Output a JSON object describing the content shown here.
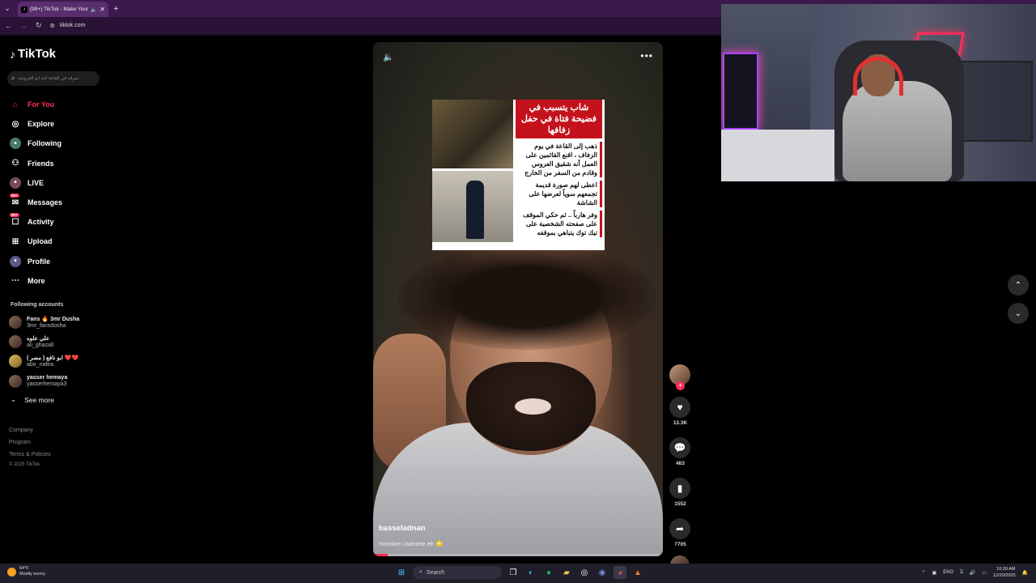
{
  "browser": {
    "tab_title": "(99+) TikTok - Make Your D...",
    "tab_close": "✕",
    "new_tab": "+",
    "url": "tiktok.com"
  },
  "sidebar": {
    "brand": "TikTok",
    "search_placeholder": "سرقه في القاعة لانه ابو العروسة",
    "nav": [
      {
        "label": "For You",
        "icon": "home-icon",
        "active": true
      },
      {
        "label": "Explore",
        "icon": "compass-icon"
      },
      {
        "label": "Following",
        "icon": "following-icon"
      },
      {
        "label": "Friends",
        "icon": "friends-icon"
      },
      {
        "label": "LIVE",
        "icon": "live-icon"
      },
      {
        "label": "Messages",
        "icon": "messages-icon",
        "badge": "99+"
      },
      {
        "label": "Activity",
        "icon": "activity-icon",
        "badge": "99+"
      },
      {
        "label": "Upload",
        "icon": "upload-icon"
      },
      {
        "label": "Profile",
        "icon": "profile-icon"
      },
      {
        "label": "More",
        "icon": "more-icon"
      }
    ],
    "following_header": "Following accounts",
    "accounts": [
      {
        "name": "Fans 🔥 3mr Dusha",
        "handle": "3mr_fansdosha"
      },
      {
        "name": "علي علوه",
        "handle": "ali_ghazall"
      },
      {
        "name": "ابو نافع ( مصر ) ❤️❤️",
        "handle": "abo_nafea"
      },
      {
        "name": "yasser hemaya",
        "handle": "yasserhemaya3"
      }
    ],
    "see_more": "See more",
    "footer": [
      "Company",
      "Program",
      "Terms & Policies"
    ],
    "copyright": "© 2025 TikTok"
  },
  "video": {
    "username": "basseladnan",
    "caption": "momken taamele eh 😳",
    "progress": 0.05,
    "overlay": {
      "title": "شاب يتسبب في فضيحة فتاة في حفل زفافها",
      "lines": [
        "ذهب إلى القاعة في يوم الزفاف ، اقنع القائمين على العمل أنه شقيق العروس وقادم من السفر من الخارج",
        "اعطى لهم صورة قديمة تجمعهم سوياً لعرضها على الشاشة",
        "وفر هارباً .. ثم حكي الموقف على صفحته الشخصية على تيك توك يتباهي بموقفه"
      ]
    }
  },
  "actions": {
    "like_count": "13.3K",
    "comment_count": "463",
    "save_count": "1552",
    "share_count": "7705"
  },
  "taskbar": {
    "weather_temp": "64°F",
    "weather_desc": "Mostly sunny",
    "search_label": "Search",
    "lang": "ENG",
    "time": "10:39 AM",
    "date": "12/29/2025"
  },
  "colors": {
    "accent": "#fe2c55",
    "chrome_bg": "#3a1a4c"
  }
}
